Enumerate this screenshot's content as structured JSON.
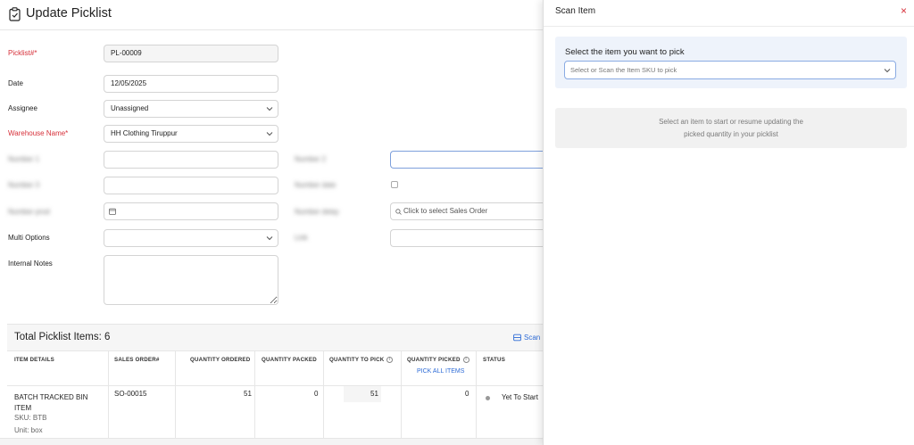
{
  "header": {
    "title": "Update Picklist"
  },
  "form": {
    "picklist_label": "Picklist#*",
    "picklist_value": "PL-00009",
    "date_label": "Date",
    "date_value": "12/05/2025",
    "assignee_label": "Assignee",
    "assignee_value": "Unassigned",
    "warehouse_label": "Warehouse Name*",
    "warehouse_value": "HH Clothing Tiruppur",
    "blurred_label_1": "Number 1",
    "blurred_label_2": "Number 2",
    "blurred_label_3": "Number 3",
    "blurred_label_4": "Number date",
    "blurred_label_5": "Number prod",
    "blurred_label_6": "Number delay",
    "blurred_label_7": "Link",
    "sales_order_placeholder": "Click to select Sales Order",
    "multi_options_label": "Multi Options",
    "internal_notes_label": "Internal Notes"
  },
  "table": {
    "title": "Total Picklist Items: 6",
    "scan_label": "Scan",
    "columns": {
      "item_details": "ITEM DETAILS",
      "sales_order": "SALES ORDER#",
      "qty_ordered": "QUANTITY ORDERED",
      "qty_packed": "QUANTITY PACKED",
      "qty_to_pick": "QUANTITY TO PICK",
      "qty_picked": "QUANTITY PICKED",
      "status": "STATUS"
    },
    "pick_all_label": "PICK ALL ITEMS",
    "rows": [
      {
        "name": "BATCH TRACKED BIN ITEM",
        "sku": "SKU: BTB",
        "unit": "Unit: box",
        "sales_order": "SO-00015",
        "qty_ordered": "51",
        "qty_packed": "0",
        "qty_to_pick": "51",
        "qty_picked": "0",
        "status": "Yet To Start"
      }
    ]
  },
  "panel": {
    "title": "Scan Item",
    "close": "×",
    "pick_label": "Select the item you want to pick",
    "pick_placeholder": "Select or Scan the Item SKU to pick",
    "info_line1": "Select an item to start or resume updating the",
    "info_line2": "picked quantity in your picklist"
  },
  "colors": {
    "accent": "#2d6bd6",
    "required": "#d6303a",
    "panel_bg": "#eef3fb"
  },
  "icons": [
    "clipboard-icon",
    "calendar-icon",
    "search-icon",
    "chevron-down-icon",
    "scan-icon",
    "info-icon",
    "close-icon"
  ]
}
